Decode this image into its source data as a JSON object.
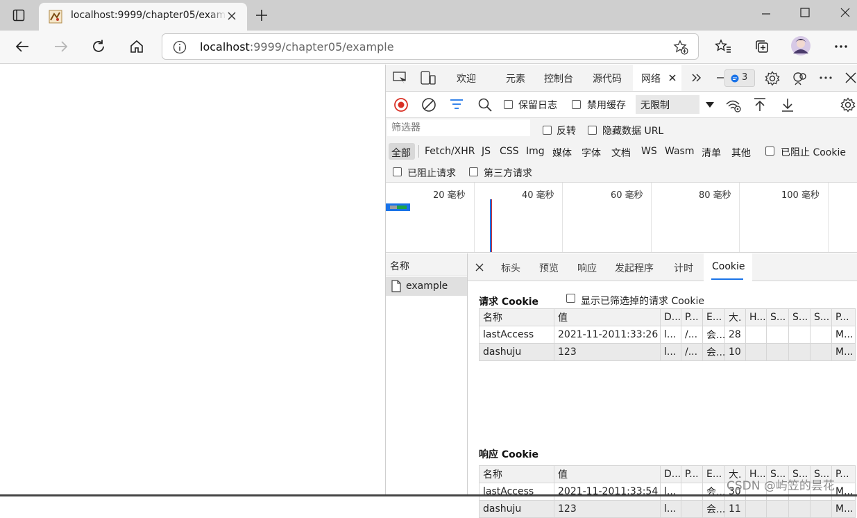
{
  "browser": {
    "tab_title": "localhost:9999/chapter05/example",
    "url_host": "localhost",
    "url_rest": ":9999/chapter05/example"
  },
  "devtools": {
    "tabs": {
      "welcome": "欢迎",
      "elements": "元素",
      "console": "控制台",
      "sources": "源代码",
      "network": "网络"
    },
    "issues_count": "3",
    "toolbar": {
      "preserve_log": "保留日志",
      "disable_cache": "禁用缓存",
      "throttle": "无限制"
    },
    "filter": {
      "placeholder": "筛选器",
      "invert": "反转",
      "hide_data_urls": "隐藏数据 URL",
      "types": [
        "全部",
        "Fetch/XHR",
        "JS",
        "CSS",
        "Img",
        "媒体",
        "字体",
        "文档",
        "WS",
        "Wasm",
        "清单",
        "其他"
      ],
      "blocked_cookies": "已阻止 Cookie",
      "blocked_requests": "已阻止请求",
      "third_party": "第三方请求"
    },
    "overview_ticks": [
      "20 毫秒",
      "40 毫秒",
      "60 毫秒",
      "80 毫秒",
      "100 毫秒"
    ],
    "request_list": {
      "header": "名称",
      "rows": [
        "example"
      ]
    },
    "detail_tabs": [
      "标头",
      "预览",
      "响应",
      "发起程序",
      "计时",
      "Cookie"
    ],
    "request_cookies": {
      "title": "请求 Cookie",
      "show_filtered": "显示已筛选掉的请求 Cookie",
      "columns": [
        "名称",
        "值",
        "D...",
        "P...",
        "E...",
        "大.",
        "H...",
        "S...",
        "S...",
        "S...",
        "P..."
      ],
      "rows": [
        [
          "lastAccess",
          "2021-11-2011:33:26",
          "l...",
          "/...",
          "会...",
          "28",
          "",
          "",
          "",
          "",
          "M..."
        ],
        [
          "dashuju",
          "123",
          "l...",
          "/...",
          "会...",
          "10",
          "",
          "",
          "",
          "",
          "M..."
        ]
      ]
    },
    "response_cookies": {
      "title": "响应 Cookie",
      "columns": [
        "名称",
        "值",
        "D...",
        "P...",
        "E...",
        "大.",
        "H...",
        "S...",
        "S...",
        "S...",
        "P..."
      ],
      "rows": [
        [
          "lastAccess",
          "2021-11-2011:33:54",
          "l...",
          "",
          "会...",
          "30",
          "",
          "",
          "",
          "",
          "M..."
        ],
        [
          "dashuju",
          "123",
          "l...",
          "",
          "会...",
          "11",
          "",
          "",
          "",
          "",
          "M..."
        ]
      ]
    }
  },
  "watermark": "CSDN @屿笠的昙花"
}
